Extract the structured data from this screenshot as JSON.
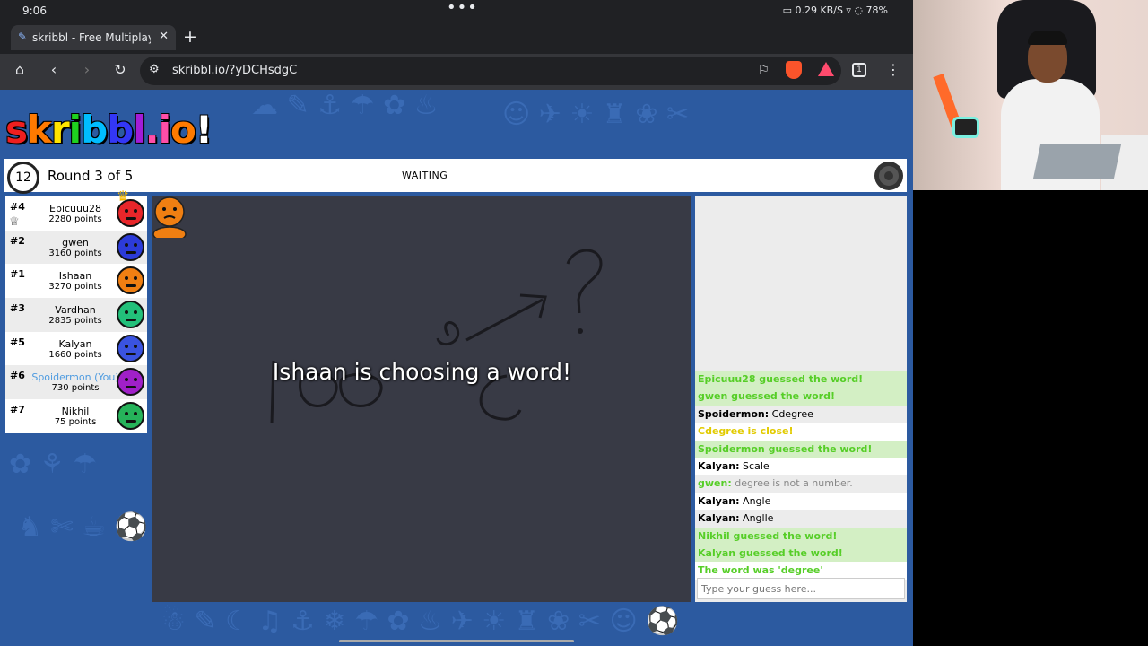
{
  "statusbar": {
    "time": "9:06",
    "dots": "•••",
    "battery": "78%",
    "indicators": "▭ 0.29 KB/S ▿ ◌"
  },
  "browser": {
    "tab_title": "skribbl - Free Multiplayer Dra",
    "tab_close": "✕",
    "new_tab": "+",
    "url": "skribbl.io/?yDCHsdgC",
    "tab_count": "1"
  },
  "game": {
    "logo": [
      "s",
      "k",
      "r",
      "i",
      "b",
      "b",
      "l",
      ".",
      "i",
      "o",
      "!"
    ],
    "logo_colors": [
      "#ef1f1f",
      "#ff7a00",
      "#ffe400",
      "#1fd11f",
      "#00bdff",
      "#3337f5",
      "#a31cd8",
      "#ff4ea8",
      "#ff4ea8",
      "#ff7a00",
      "#ffffff"
    ],
    "timer": "12",
    "round": "Round 3 of 5",
    "status": "WAITING",
    "choosing_text": "Ishaan is choosing a word!",
    "guess_placeholder": "Type your guess here..."
  },
  "players": [
    {
      "rank": "#4",
      "name": "Epicuuu28",
      "points": "2280 points",
      "color": "#e8262a",
      "crown_icon": true
    },
    {
      "rank": "#2",
      "name": "gwen",
      "points": "3160 points",
      "color": "#2c3bd9"
    },
    {
      "rank": "#1",
      "name": "Ishaan",
      "points": "3270 points",
      "color": "#f07f12"
    },
    {
      "rank": "#3",
      "name": "Vardhan",
      "points": "2835 points",
      "color": "#22c07a"
    },
    {
      "rank": "#5",
      "name": "Kalyan",
      "points": "1660 points",
      "color": "#3a53e0"
    },
    {
      "rank": "#6",
      "name": "Spoidermon (You)",
      "points": "730 points",
      "color": "#a020c8",
      "self": true
    },
    {
      "rank": "#7",
      "name": "Nikhil",
      "points": "75 points",
      "color": "#26b35a"
    }
  ],
  "chat": [
    {
      "type": "green",
      "text": "Epicuuu28 guessed the word!"
    },
    {
      "type": "green",
      "text": "gwen guessed the word!"
    },
    {
      "type": "grey",
      "author": "Spoidermon:",
      "text": " Cdegree"
    },
    {
      "type": "close",
      "text": "Cdegree is close!"
    },
    {
      "type": "green",
      "text": "Spoidermon guessed the word!"
    },
    {
      "type": "white",
      "author": "Kalyan:",
      "text": " Scale"
    },
    {
      "type": "greyline",
      "author": "gwen:",
      "text": " degree is not a number."
    },
    {
      "type": "white",
      "author": "Kalyan:",
      "text": " Angle"
    },
    {
      "type": "grey",
      "author": "Kalyan:",
      "text": " Anglle"
    },
    {
      "type": "green",
      "text": "Nikhil guessed the word!"
    },
    {
      "type": "green",
      "text": "Kalyan guessed the word!"
    },
    {
      "type": "white_green",
      "text": "The word was 'degree'"
    }
  ]
}
